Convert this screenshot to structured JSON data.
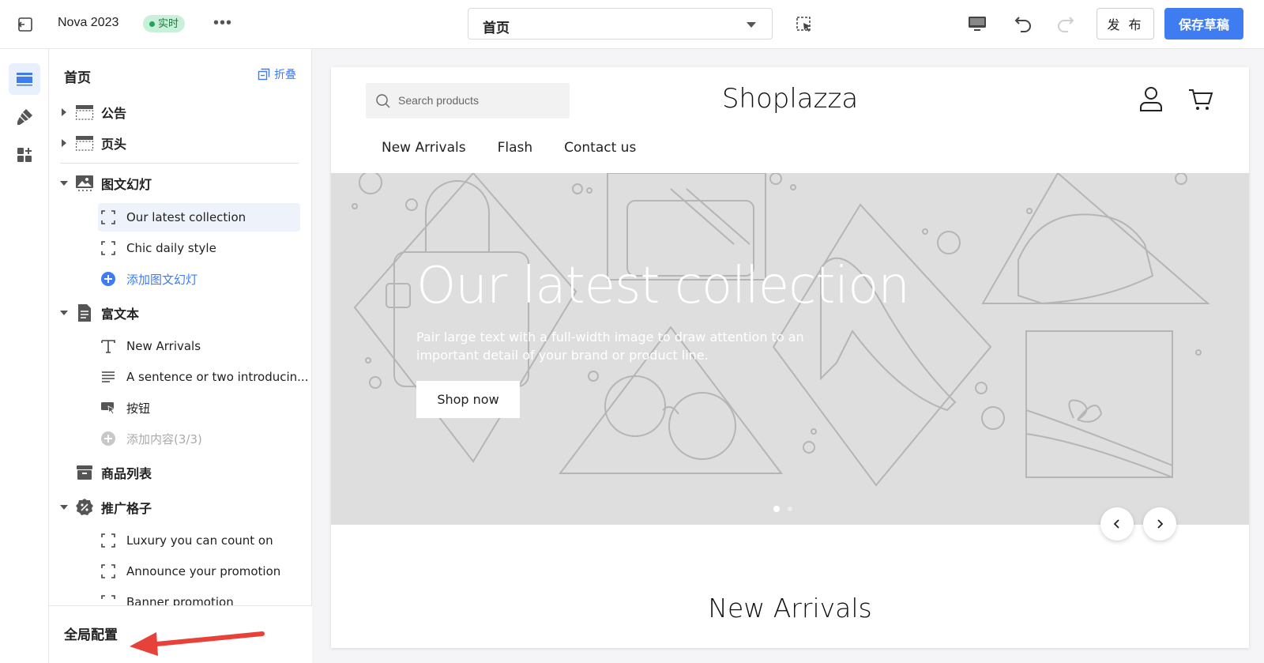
{
  "topbar": {
    "title": "Nova 2023",
    "badge": "实时",
    "page_select": "首页",
    "publish_label": "发 布",
    "save_label": "保存草稿"
  },
  "sidebar": {
    "title": "首页",
    "fold_label": "折叠",
    "items": [
      {
        "label": "公告"
      },
      {
        "label": "页头"
      },
      {
        "label": "图文幻灯"
      },
      {
        "label": "Our latest collection"
      },
      {
        "label": "Chic daily style"
      },
      {
        "label": "添加图文幻灯"
      },
      {
        "label": "富文本"
      },
      {
        "label": "New Arrivals"
      },
      {
        "label": "A sentence or two introducin..."
      },
      {
        "label": "按钮"
      },
      {
        "label": "添加内容(3/3)"
      },
      {
        "label": "商品列表"
      },
      {
        "label": "推广格子"
      },
      {
        "label": "Luxury you can count on"
      },
      {
        "label": "Announce your promotion"
      },
      {
        "label": "Banner promotion"
      }
    ],
    "global_config": "全局配置"
  },
  "preview": {
    "search_placeholder": "Search products",
    "logo": "Shoplazza",
    "nav": [
      "New Arrivals",
      "Flash",
      "Contact us"
    ],
    "hero_title": "Our latest collection",
    "hero_subtitle": "Pair large text with a full-width image to draw attention to an important detail of your brand or product line.",
    "hero_button": "Shop now",
    "section_title": "New Arrivals"
  },
  "colors": {
    "accent": "#3f7cf2",
    "badge_bg": "#c9f0d8",
    "annotation": "#e8413a"
  }
}
